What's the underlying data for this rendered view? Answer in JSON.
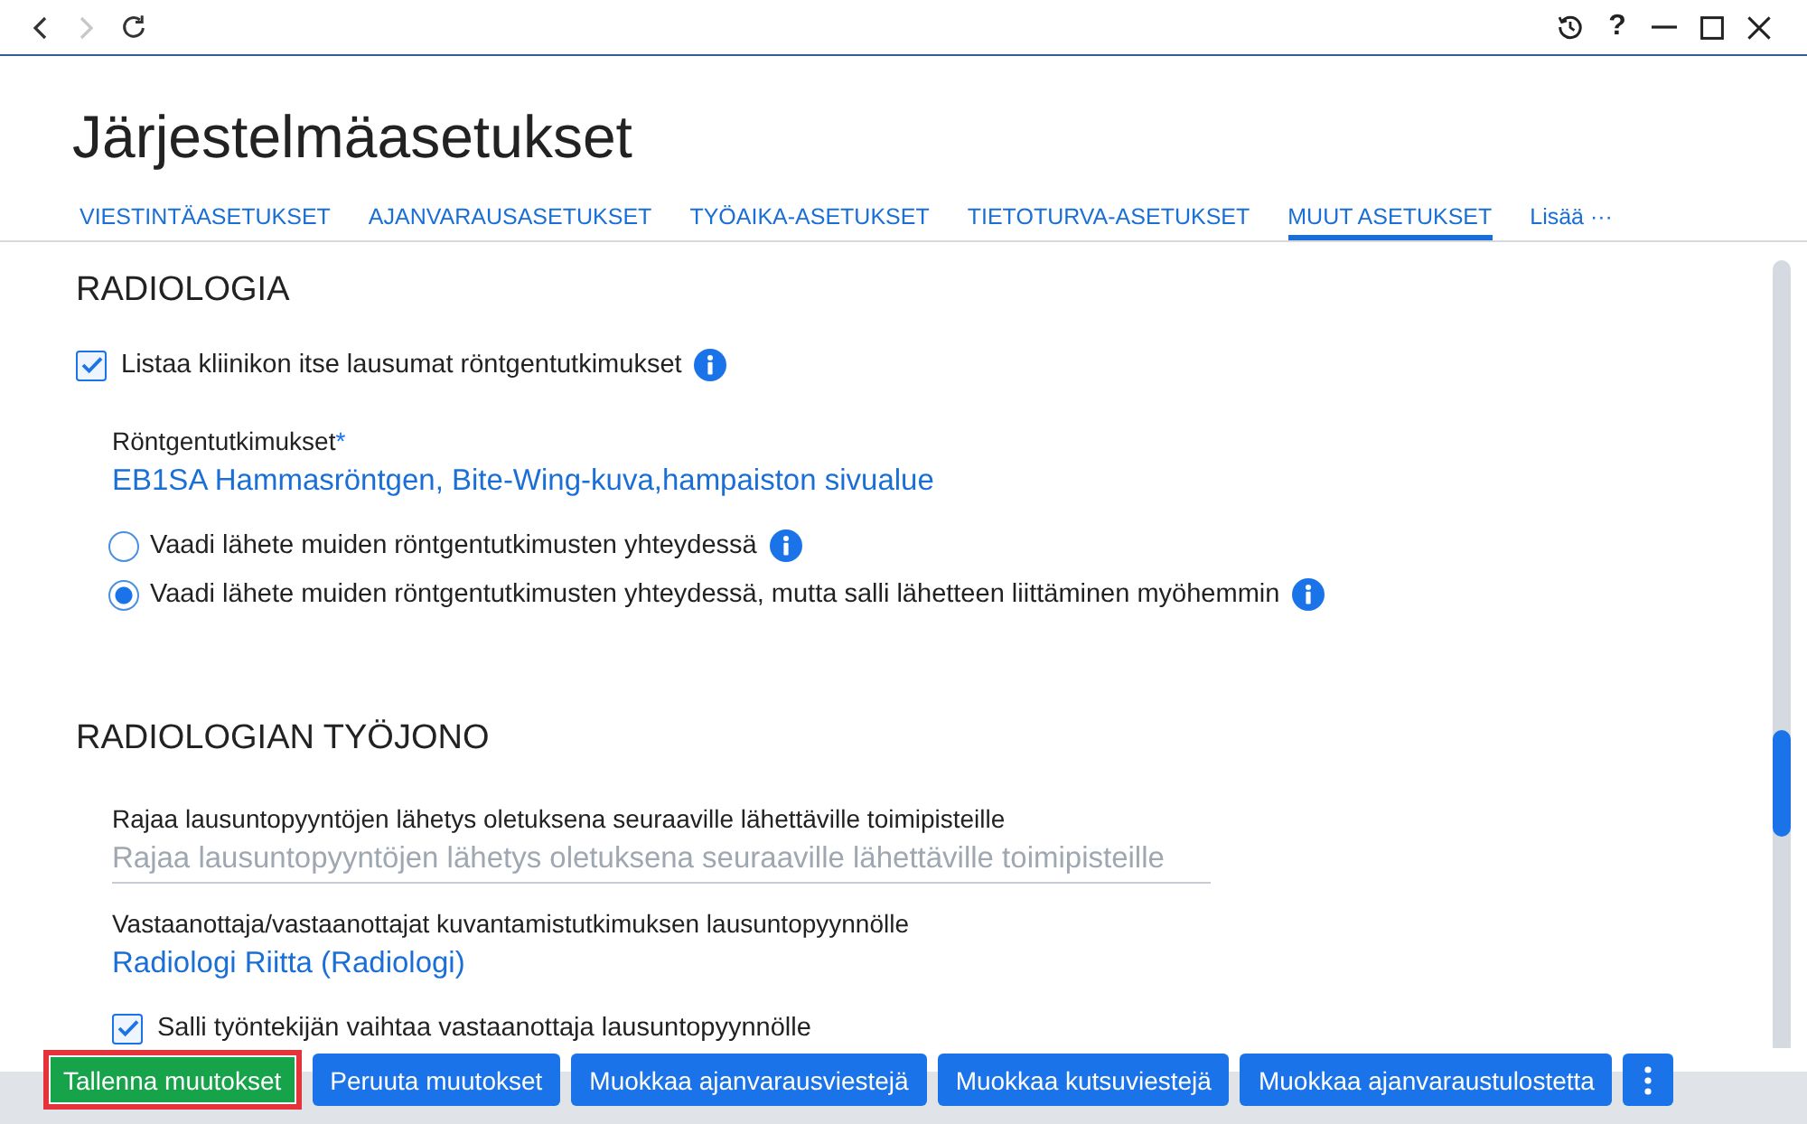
{
  "nav": [
    {
      "kind": "back",
      "disabled": false
    },
    {
      "kind": "forward",
      "disabled": true
    },
    {
      "kind": "refresh",
      "disabled": false
    }
  ],
  "window_controls": [
    {
      "kind": "history"
    },
    {
      "kind": "help",
      "label": "?"
    },
    {
      "kind": "minimize"
    },
    {
      "kind": "maximize"
    },
    {
      "kind": "close"
    }
  ],
  "page": {
    "title": "Järjestelmäasetukset"
  },
  "tabs": [
    {
      "label": "VIESTINTÄASETUKSET",
      "selected": false
    },
    {
      "label": "AJANVARAUSASETUKSET",
      "selected": false
    },
    {
      "label": "TYÖAIKA-ASETUKSET",
      "selected": false
    },
    {
      "label": "TIETOTURVA-ASETUKSET",
      "selected": false
    },
    {
      "label": "MUUT ASETUKSET",
      "selected": true
    },
    {
      "label": "Lisää ···",
      "selected": false
    }
  ],
  "sections": [
    {
      "heading": "RADIOLOGIA",
      "toggle": {
        "kind": "checkbox",
        "label": "Listaa kliinikon itse lausumat röntgentutkimukset",
        "checked": true,
        "info": true
      },
      "fields": [
        {
          "kind": "value",
          "label": "Röntgentutkimukset",
          "required_mark": "*",
          "value": "EB1SA Hammasröntgen, Bite-Wing-kuva,hampaiston sivualue"
        },
        {
          "kind": "radio",
          "label": "Vaadi lähete muiden röntgentutkimusten yhteydessä",
          "selected": false,
          "info": true
        },
        {
          "kind": "radio",
          "label": "Vaadi lähete muiden röntgentutkimusten yhteydessä, mutta salli lähetteen liittäminen myöhemmin",
          "selected": true,
          "info": true
        }
      ]
    },
    {
      "heading": "RADIOLOGIAN TYÖJONO",
      "fields": [
        {
          "kind": "input",
          "label": "Rajaa lausuntopyyntöjen lähetys oletuksena seuraaville lähettäville toimipisteille",
          "placeholder": "Rajaa lausuntopyyntöjen lähetys oletuksena seuraaville lähettäville toimipisteille"
        },
        {
          "kind": "value",
          "label": "Vastaanottaja/vastaanottajat kuvantamistutkimuksen lausuntopyynnölle",
          "value": "Radiologi Riitta (Radiologi)"
        },
        {
          "kind": "checkbox",
          "label": "Salli työntekijän vaihtaa vastaanottaja lausuntopyynnölle",
          "checked": true,
          "info": false
        }
      ]
    }
  ],
  "footer_buttons": [
    {
      "kind": "save",
      "label": "Tallenna muutokset",
      "highlighted": true
    },
    {
      "kind": "action",
      "label": "Peruuta muutokset",
      "highlighted": false
    },
    {
      "kind": "action",
      "label": "Muokkaa ajanvarausviestejä",
      "highlighted": false
    },
    {
      "kind": "action",
      "label": "Muokkaa kutsuviestejä",
      "highlighted": false
    },
    {
      "kind": "action",
      "label": "Muokkaa ajanvaraustulostetta",
      "highlighted": false
    },
    {
      "kind": "more",
      "highlighted": false
    }
  ]
}
